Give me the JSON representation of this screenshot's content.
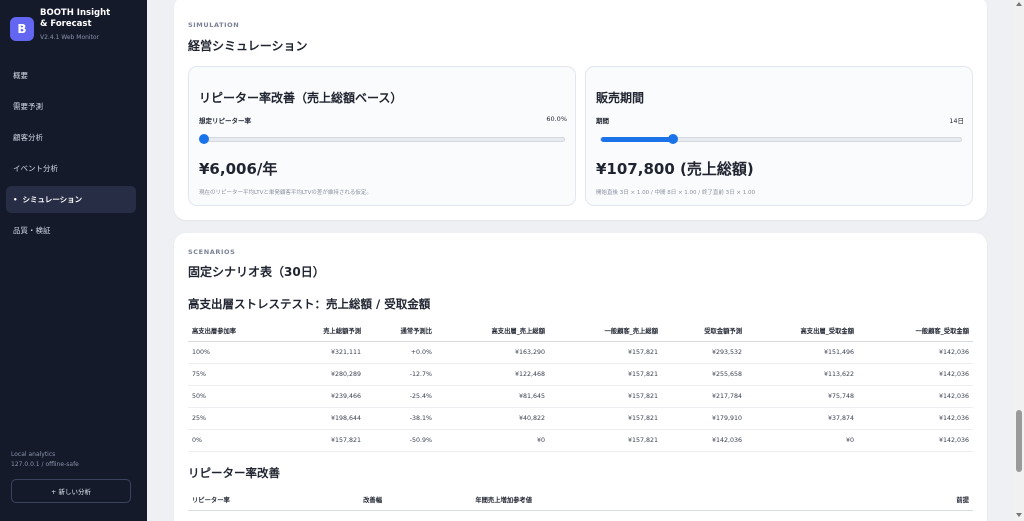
{
  "sidebar": {
    "logo_letter": "B",
    "app_title": "BOOTH Insight & Forecast",
    "version": "V2.4.1 Web Monitor",
    "nav": [
      {
        "label": "概要"
      },
      {
        "label": "需要予測"
      },
      {
        "label": "顧客分析"
      },
      {
        "label": "イベント分析"
      },
      {
        "label": "シミュレーション",
        "active": true
      },
      {
        "label": "品質・検証"
      }
    ],
    "active_marker": "•",
    "footer_line1": "Local analytics",
    "footer_line2": "127.0.0.1 / offline-safe",
    "new_button": "+ 新しい分析"
  },
  "simulation": {
    "section_label": "SIMULATION",
    "title": "経営シミュレーション",
    "repeater": {
      "title": "リピーター率改善（売上総額ベース）",
      "slider_label": "想定リピーター率",
      "slider_value": "60.0%",
      "slider_fraction": 0.0,
      "result": "¥6,006/年",
      "note": "現在のリピーター平均LTVと単発顧客平均LTVの差が維持される仮定。"
    },
    "period": {
      "title": "販売期間",
      "slider_label": "期間",
      "slider_value": "14日",
      "slider_fraction": 0.2,
      "result": "¥107,800 (売上総額)",
      "note": "開始直後 3日 × 1.00 / 中間 8日 × 1.00 / 終了直前 3日 × 1.00"
    }
  },
  "scenarios": {
    "section_label": "SCENARIOS",
    "title": "固定シナリオ表（30日）",
    "stress": {
      "title": "高支出層ストレステスト：売上総額 / 受取金額",
      "headers": [
        "高支出層参加率",
        "売上総額予測",
        "通常予測比",
        "高支出層_売上総額",
        "一般顧客_売上総額",
        "受取金額予測",
        "高支出層_受取金額",
        "一般顧客_受取金額"
      ],
      "rows": [
        [
          "100%",
          "¥321,111",
          "+0.0%",
          "¥163,290",
          "¥157,821",
          "¥293,532",
          "¥151,496",
          "¥142,036"
        ],
        [
          "75%",
          "¥280,289",
          "-12.7%",
          "¥122,468",
          "¥157,821",
          "¥255,658",
          "¥113,622",
          "¥142,036"
        ],
        [
          "50%",
          "¥239,466",
          "-25.4%",
          "¥81,645",
          "¥157,821",
          "¥217,784",
          "¥75,748",
          "¥142,036"
        ],
        [
          "25%",
          "¥198,644",
          "-38.1%",
          "¥40,822",
          "¥157,821",
          "¥179,910",
          "¥37,874",
          "¥142,036"
        ],
        [
          "0%",
          "¥157,821",
          "-50.9%",
          "¥0",
          "¥157,821",
          "¥142,036",
          "¥0",
          "¥142,036"
        ]
      ]
    },
    "repeater_table": {
      "title": "リピーター率改善",
      "headers": [
        "リピーター率",
        "改善幅",
        "年間売上増加参考値",
        "前提"
      ]
    }
  }
}
